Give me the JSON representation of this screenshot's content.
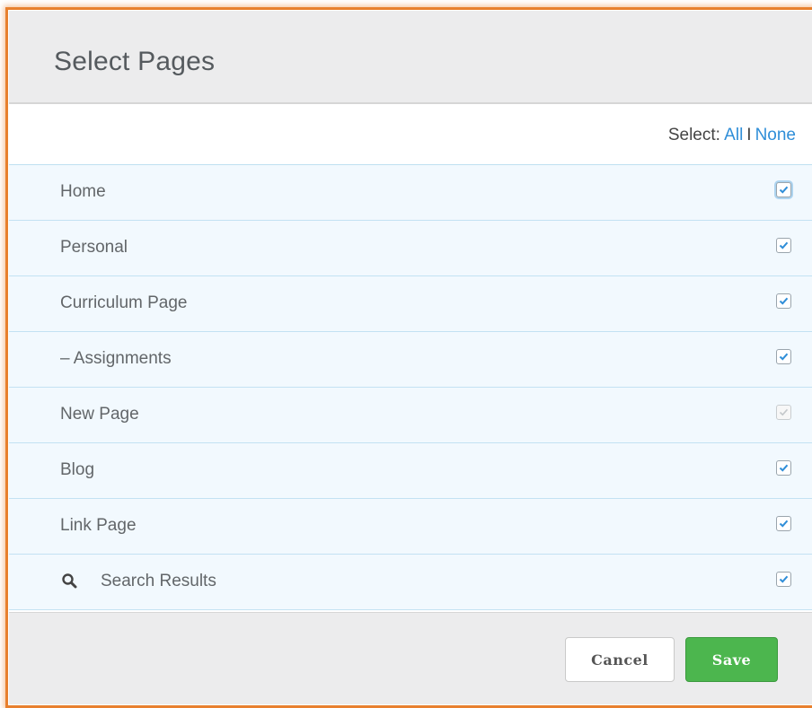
{
  "dialog": {
    "title": "Select Pages"
  },
  "selector": {
    "prefix": "Select:",
    "all_label": "All",
    "separator": "I",
    "none_label": "None"
  },
  "pages": [
    {
      "label": "Home",
      "checked": true,
      "disabled": false
    },
    {
      "label": "Personal",
      "checked": true,
      "disabled": false
    },
    {
      "label": "Curriculum Page",
      "checked": true,
      "disabled": false
    },
    {
      "label": "– Assignments",
      "checked": true,
      "disabled": false
    },
    {
      "label": "New Page",
      "checked": true,
      "disabled": true
    },
    {
      "label": "Blog",
      "checked": true,
      "disabled": false
    },
    {
      "label": "Link Page",
      "checked": true,
      "disabled": false
    },
    {
      "label": "Search Results",
      "checked": true,
      "disabled": false,
      "icon": "search-icon"
    }
  ],
  "footer": {
    "cancel_label": "Cancel",
    "save_label": "Save"
  },
  "colors": {
    "accent": "#2f8ed8",
    "save": "#4cb64e",
    "frame": "#e8802e"
  }
}
